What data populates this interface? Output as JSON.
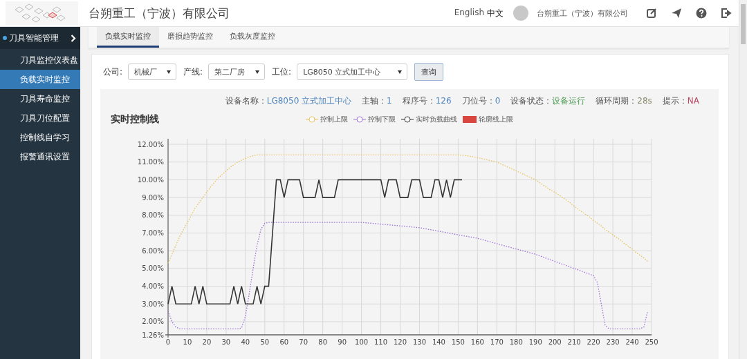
{
  "header": {
    "title": "台朔重工（宁波）有限公司",
    "languages": [
      {
        "label": "English",
        "selected": false
      },
      {
        "label": "中文",
        "selected": true
      }
    ],
    "company": "台朔重工（宁波）有限公司"
  },
  "sidebar": {
    "group": "刀具智能管理",
    "items": [
      {
        "label": "刀具监控仪表盘",
        "selected": false
      },
      {
        "label": "负载实时监控",
        "selected": true
      },
      {
        "label": "刀具寿命监控",
        "selected": false
      },
      {
        "label": "刀具刀位配置",
        "selected": false
      },
      {
        "label": "控制线自学习",
        "selected": false
      },
      {
        "label": "报警通讯设置",
        "selected": false
      }
    ]
  },
  "tabs": [
    {
      "label": "负载实时监控",
      "selected": true
    },
    {
      "label": "磨损趋势监控",
      "selected": false
    },
    {
      "label": "负载灰度监控",
      "selected": false
    }
  ],
  "filters": [
    {
      "label": "公司:",
      "value": "机械厂"
    },
    {
      "label": "产线:",
      "value": "第二厂房"
    },
    {
      "label": "工位:",
      "value": "LG8050 立式加工中心"
    }
  ],
  "query_button": "查询",
  "info": [
    {
      "label": "设备名称：",
      "value": "LG8050 立式加工中心",
      "color": "#4f86bd"
    },
    {
      "label": "主轴：",
      "value": "1",
      "color": "#4f86bd"
    },
    {
      "label": "程序号：",
      "value": "126",
      "color": "#4f86bd"
    },
    {
      "label": "刀位号：",
      "value": "0",
      "color": "#4f86bd"
    },
    {
      "label": "设备状态：",
      "value": "设备运行",
      "color": "#4e9a52"
    },
    {
      "label": "循环周期：",
      "value": "28s",
      "color": "#8b8b6e"
    },
    {
      "label": "提示：",
      "value": "NA",
      "color": "#b84a66"
    }
  ],
  "chart": {
    "title": "实时控制线",
    "extra_legend": [
      {
        "label": "轮廓线上限",
        "color": "#d9463f"
      }
    ],
    "chart_data": {
      "type": "line",
      "grid": true,
      "xlim": [
        0,
        250
      ],
      "ylim": [
        1.26,
        12
      ],
      "xticks": [
        0,
        10,
        20,
        30,
        40,
        50,
        60,
        70,
        80,
        90,
        100,
        110,
        120,
        130,
        140,
        150,
        160,
        170,
        180,
        190,
        200,
        210,
        220,
        230,
        240,
        250
      ],
      "yticks": [
        {
          "value": 1.26,
          "label": "1.26%"
        },
        {
          "value": 2,
          "label": "2.00%"
        },
        {
          "value": 3,
          "label": "3.00%"
        },
        {
          "value": 4,
          "label": "4.00%"
        },
        {
          "value": 5,
          "label": "5.00%"
        },
        {
          "value": 6,
          "label": "6.00%"
        },
        {
          "value": 7,
          "label": "7.00%"
        },
        {
          "value": 8,
          "label": "8.00%"
        },
        {
          "value": 9,
          "label": "9.00%"
        },
        {
          "value": 10,
          "label": "10.00%"
        },
        {
          "value": 11,
          "label": "11.00%"
        },
        {
          "value": 12,
          "label": "12.00%"
        }
      ],
      "x": [
        0,
        2,
        4,
        6,
        8,
        10,
        12,
        14,
        16,
        18,
        20,
        22,
        24,
        26,
        28,
        30,
        32,
        34,
        36,
        38,
        40,
        42,
        44,
        46,
        48,
        50,
        52,
        54,
        56,
        58,
        60,
        62,
        64,
        66,
        68,
        70,
        72,
        74,
        76,
        78,
        80,
        82,
        84,
        86,
        88,
        90,
        92,
        94,
        96,
        98,
        100,
        102,
        104,
        106,
        108,
        110,
        112,
        114,
        116,
        118,
        120,
        122,
        124,
        126,
        128,
        130,
        132,
        134,
        136,
        138,
        140,
        142,
        144,
        146,
        148,
        150,
        152,
        154,
        156,
        158,
        160,
        162,
        164,
        166,
        168,
        170,
        172,
        174,
        176,
        178,
        180,
        182,
        184,
        186,
        188,
        190,
        192,
        194,
        196,
        198,
        200,
        202,
        204,
        206,
        208,
        210,
        212,
        214,
        216,
        218,
        220,
        222,
        224,
        226,
        228,
        230,
        232,
        234,
        236,
        238,
        240,
        242,
        244,
        246,
        248
      ],
      "series": [
        {
          "name": "控制上限",
          "color": "#e8c35a",
          "line_style": "dotted",
          "values": [
            5.3,
            5.8,
            6.3,
            6.8,
            7.2,
            7.6,
            8.0,
            8.4,
            8.7,
            9.0,
            9.3,
            9.6,
            9.85,
            10.1,
            10.3,
            10.5,
            10.7,
            10.85,
            11.0,
            11.1,
            11.2,
            11.3,
            11.35,
            11.4,
            11.4,
            11.4,
            11.4,
            11.4,
            11.4,
            11.4,
            11.4,
            11.4,
            11.4,
            11.4,
            11.4,
            11.4,
            11.4,
            11.4,
            11.4,
            11.4,
            11.4,
            11.4,
            11.4,
            11.4,
            11.4,
            11.4,
            11.4,
            11.4,
            11.4,
            11.4,
            11.4,
            11.4,
            11.4,
            11.4,
            11.4,
            11.4,
            11.4,
            11.4,
            11.4,
            11.4,
            11.4,
            11.4,
            11.4,
            11.4,
            11.4,
            11.4,
            11.4,
            11.4,
            11.4,
            11.4,
            11.4,
            11.4,
            11.4,
            11.4,
            11.4,
            11.4,
            11.38,
            11.36,
            11.34,
            11.3,
            11.25,
            11.2,
            11.15,
            11.1,
            11.05,
            11.0,
            10.9,
            10.8,
            10.7,
            10.6,
            10.5,
            10.4,
            10.3,
            10.2,
            10.1,
            10.0,
            9.85,
            9.7,
            9.55,
            9.4,
            9.3,
            9.15,
            9.0,
            8.85,
            8.7,
            8.5,
            8.35,
            8.2,
            8.05,
            7.9,
            7.7,
            7.55,
            7.4,
            7.2,
            7.05,
            6.9,
            6.75,
            6.6,
            6.4,
            6.25,
            6.1,
            5.9,
            5.75,
            5.6,
            5.4
          ]
        },
        {
          "name": "控制下限",
          "color": "#9b6fd6",
          "line_style": "dotted",
          "values": [
            2.6,
            2.0,
            1.7,
            1.6,
            1.6,
            1.6,
            1.6,
            1.6,
            1.6,
            1.6,
            1.6,
            1.6,
            1.6,
            1.6,
            1.6,
            1.6,
            1.6,
            1.6,
            1.6,
            1.65,
            2.3,
            3.6,
            5.0,
            6.3,
            7.2,
            7.55,
            7.6,
            7.6,
            7.6,
            7.6,
            7.6,
            7.6,
            7.6,
            7.6,
            7.6,
            7.6,
            7.6,
            7.6,
            7.6,
            7.6,
            7.6,
            7.6,
            7.6,
            7.6,
            7.6,
            7.6,
            7.6,
            7.6,
            7.6,
            7.6,
            7.6,
            7.58,
            7.56,
            7.54,
            7.52,
            7.5,
            7.48,
            7.46,
            7.44,
            7.42,
            7.4,
            7.38,
            7.36,
            7.34,
            7.32,
            7.3,
            7.26,
            7.22,
            7.18,
            7.14,
            7.1,
            7.06,
            7.02,
            6.98,
            6.94,
            6.9,
            6.86,
            6.82,
            6.78,
            6.74,
            6.7,
            6.64,
            6.58,
            6.52,
            6.46,
            6.4,
            6.34,
            6.28,
            6.22,
            6.16,
            6.1,
            6.04,
            5.98,
            5.92,
            5.86,
            5.8,
            5.72,
            5.64,
            5.56,
            5.48,
            5.4,
            5.32,
            5.24,
            5.16,
            5.08,
            5.0,
            4.92,
            4.84,
            4.76,
            4.68,
            4.6,
            4.2,
            3.0,
            1.8,
            1.6,
            1.6,
            1.6,
            1.6,
            1.6,
            1.6,
            1.6,
            1.6,
            1.6,
            1.7,
            2.6
          ]
        },
        {
          "name": "实时负载曲线",
          "color": "#333333",
          "line_style": "solid",
          "values": [
            3,
            4,
            3,
            3,
            3,
            3,
            3,
            4,
            3,
            4,
            3,
            3,
            3,
            3,
            3,
            3,
            3,
            4,
            3,
            4,
            3,
            3,
            3,
            4,
            3,
            4,
            4,
            7,
            10,
            10,
            9,
            10,
            10,
            10,
            10,
            9,
            9,
            9,
            9,
            10,
            9,
            9,
            9,
            9,
            10,
            10,
            10,
            10,
            10,
            10,
            10,
            10,
            10,
            10,
            10,
            10,
            9,
            10,
            10,
            10,
            9,
            9,
            9,
            10,
            10,
            10,
            9,
            9,
            9,
            10,
            10,
            9,
            10,
            9,
            10,
            10,
            10,
            null,
            null,
            null,
            null,
            null,
            null,
            null,
            null,
            null,
            null,
            null,
            null,
            null,
            null,
            null,
            null,
            null,
            null,
            null,
            null,
            null,
            null,
            null,
            null,
            null,
            null,
            null,
            null,
            null,
            null,
            null,
            null,
            null,
            null,
            null,
            null,
            null,
            null,
            null,
            null,
            null,
            null,
            null,
            null,
            null,
            null,
            null,
            null
          ]
        }
      ]
    }
  }
}
